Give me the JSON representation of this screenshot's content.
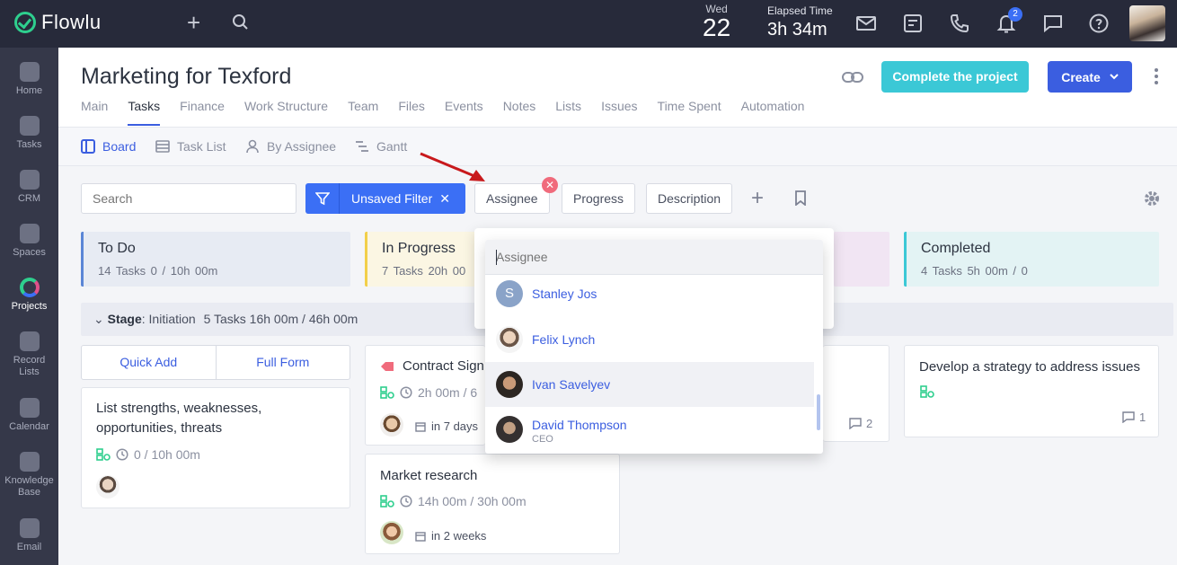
{
  "app": {
    "name": "Flowlu"
  },
  "topbar": {
    "date_dow": "Wed",
    "date_day": "22",
    "elapsed_label": "Elapsed Time",
    "elapsed_value": "3h 34m",
    "notification_count": "2"
  },
  "sidebar": {
    "items": [
      {
        "label": "Home"
      },
      {
        "label": "Tasks"
      },
      {
        "label": "CRM"
      },
      {
        "label": "Spaces"
      },
      {
        "label": "Projects"
      },
      {
        "label": "Record Lists"
      },
      {
        "label": "Calendar"
      },
      {
        "label": "Knowledge Base"
      },
      {
        "label": "Email"
      }
    ]
  },
  "project": {
    "title": "Marketing for Texford",
    "complete_label": "Complete the project",
    "create_label": "Create"
  },
  "tabs": [
    "Main",
    "Tasks",
    "Finance",
    "Work Structure",
    "Team",
    "Files",
    "Events",
    "Notes",
    "Lists",
    "Issues",
    "Time Spent",
    "Automation"
  ],
  "active_tab": "Tasks",
  "views": {
    "board": "Board",
    "task_list": "Task List",
    "by_assignee": "By Assignee",
    "gantt": "Gantt"
  },
  "filters": {
    "search_placeholder": "Search",
    "unsaved_filter": "Unsaved Filter",
    "chip_assignee": "Assignee",
    "chip_progress": "Progress",
    "chip_description": "Description"
  },
  "columns": [
    {
      "title": "To Do",
      "meta": "14 Tasks   0 / 10h 00m",
      "color": "#5b86d6"
    },
    {
      "title": "In Progress",
      "meta": "7 Tasks   20h 00",
      "color": "#f2cf4a"
    },
    {
      "title": "Completed",
      "meta": "4 Tasks   5h 00m / 0",
      "color": "#3bc8d6"
    }
  ],
  "stage": {
    "label": "Stage",
    "name": ": Initiation",
    "summary": "5 Tasks  16h 00m / 46h 00m"
  },
  "quick_add": {
    "quick": "Quick Add",
    "full": "Full Form"
  },
  "cards": {
    "todo_1": {
      "title": "List strengths, weaknesses, opportunities, threats",
      "time": "0 / 10h 00m"
    },
    "prog_1": {
      "title": "Contract Sign",
      "time": "2h 00m   / 6",
      "due": "in 7 days"
    },
    "prog_2": {
      "title": "Market research",
      "time": "14h 00m   / 30h 00m",
      "due": "in 2 weeks"
    },
    "mid_comments": "2",
    "done_1": {
      "title": "Develop a strategy to address issues",
      "comments": "1"
    }
  },
  "assignee_dropdown": {
    "placeholder": "Assignee",
    "users": [
      {
        "name": "Stanley Jos",
        "initial": "S"
      },
      {
        "name": "Felix Lynch"
      },
      {
        "name": "Ivan Savelyev"
      },
      {
        "name": "David Thompson",
        "role": "CEO"
      }
    ]
  }
}
